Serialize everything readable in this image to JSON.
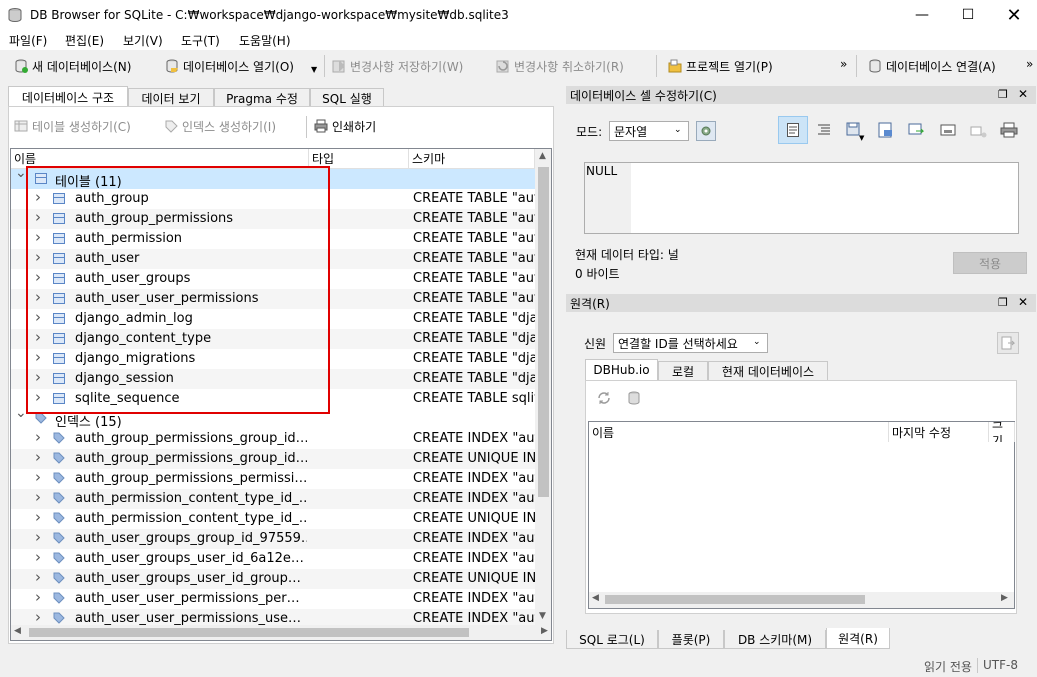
{
  "window": {
    "title": "DB Browser for SQLite - C:₩workspace₩django-workspace₩mysite₩db.sqlite3"
  },
  "menu": [
    "파일(F)",
    "편집(E)",
    "보기(V)",
    "도구(T)",
    "도움말(H)"
  ],
  "toolbar": {
    "new_db": "새 데이터베이스(N)",
    "open_db": "데이터베이스 열기(O)",
    "write_changes": "변경사항 저장하기(W)",
    "revert_changes": "변경사항 취소하기(R)",
    "open_project": "프로젝트 열기(P)",
    "attach_db": "데이터베이스 연결(A)",
    "more": "»"
  },
  "left_tabs": [
    "데이터베이스 구조",
    "데이터 보기",
    "Pragma 수정",
    "SQL 실행"
  ],
  "structure_toolbar": {
    "create_table": "테이블 생성하기(C)",
    "create_index": "인덱스 생성하기(I)",
    "print": "인쇄하기"
  },
  "tree": {
    "columns": [
      "이름",
      "타입",
      "스키마"
    ],
    "tables_group": "테이블 (11)",
    "tables": [
      {
        "name": "auth_group",
        "schema": "CREATE TABLE \"aut"
      },
      {
        "name": "auth_group_permissions",
        "schema": "CREATE TABLE \"aut"
      },
      {
        "name": "auth_permission",
        "schema": "CREATE TABLE \"aut"
      },
      {
        "name": "auth_user",
        "schema": "CREATE TABLE \"aut"
      },
      {
        "name": "auth_user_groups",
        "schema": "CREATE TABLE \"aut"
      },
      {
        "name": "auth_user_user_permissions",
        "schema": "CREATE TABLE \"aut"
      },
      {
        "name": "django_admin_log",
        "schema": "CREATE TABLE \"dja"
      },
      {
        "name": "django_content_type",
        "schema": "CREATE TABLE \"dja"
      },
      {
        "name": "django_migrations",
        "schema": "CREATE TABLE \"dja"
      },
      {
        "name": "django_session",
        "schema": "CREATE TABLE \"dja"
      },
      {
        "name": "sqlite_sequence",
        "schema": "CREATE TABLE sqlit"
      }
    ],
    "indices_group": "인덱스 (15)",
    "indices": [
      {
        "name": "auth_group_permissions_group_id…",
        "schema": "CREATE INDEX \"auth"
      },
      {
        "name": "auth_group_permissions_group_id…",
        "schema": "CREATE UNIQUE IND"
      },
      {
        "name": "auth_group_permissions_permissi…",
        "schema": "CREATE INDEX \"auth"
      },
      {
        "name": "auth_permission_content_type_id_…",
        "schema": "CREATE INDEX \"auth"
      },
      {
        "name": "auth_permission_content_type_id_…",
        "schema": "CREATE UNIQUE IND"
      },
      {
        "name": "auth_user_groups_group_id_97559…",
        "schema": "CREATE INDEX \"auth"
      },
      {
        "name": "auth_user_groups_user_id_6a12e…",
        "schema": "CREATE INDEX \"auth"
      },
      {
        "name": "auth_user_groups_user_id_group…",
        "schema": "CREATE UNIQUE IND"
      },
      {
        "name": "auth_user_user_permissions_per…",
        "schema": "CREATE INDEX \"auth"
      },
      {
        "name": "auth_user_user_permissions_use…",
        "schema": "CREATE INDEX \"auth"
      }
    ]
  },
  "edit_cell": {
    "title": "데이터베이스 셀 수정하기(C)",
    "mode_label": "모드:",
    "mode_value": "문자열",
    "cell_value": "NULL",
    "data_type": "현재 데이터 타입: 널",
    "size": "0 바이트",
    "apply": "적용"
  },
  "remote": {
    "title": "원격(R)",
    "identity_label": "신원",
    "identity_value": "연결할 ID를 선택하세요",
    "tabs": [
      "DBHub.io",
      "로컬",
      "현재 데이터베이스"
    ],
    "columns": [
      "이름",
      "마지막 수정",
      "크기"
    ]
  },
  "bottom_tabs": [
    "SQL 로그(L)",
    "플롯(P)",
    "DB 스키마(M)",
    "원격(R)"
  ],
  "status": {
    "read_only": "읽기 전용",
    "encoding": "UTF-8"
  },
  "colors": {
    "highlight_box": "#e00000",
    "selected_row": "#cce8ff"
  }
}
